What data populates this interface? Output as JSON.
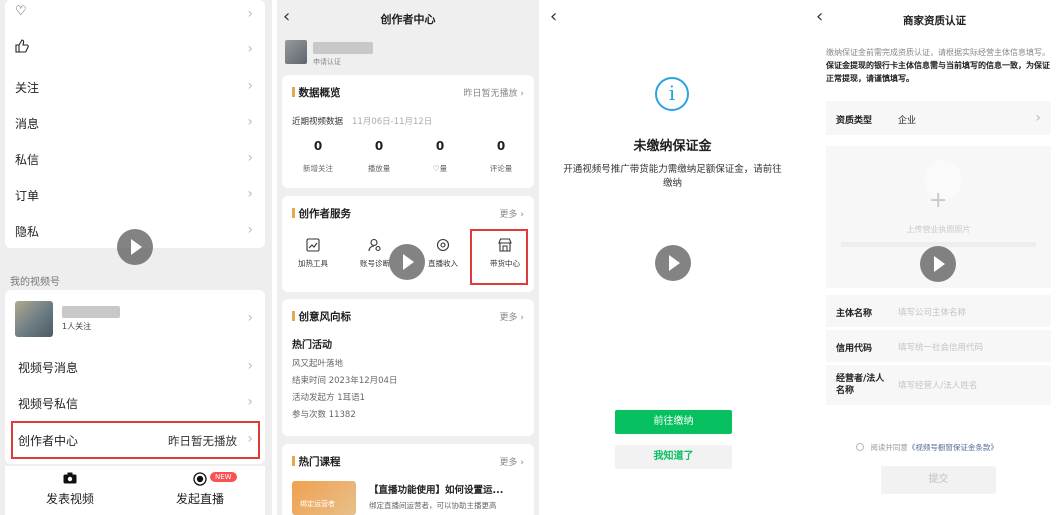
{
  "screen1": {
    "menu_items": [
      {
        "label": "",
        "icon": "heart-icon"
      },
      {
        "label": "",
        "icon": "thumbs-up-icon"
      },
      {
        "label": "关注"
      },
      {
        "label": "消息"
      },
      {
        "label": "私信"
      },
      {
        "label": "订单"
      },
      {
        "label": "隐私"
      }
    ],
    "section_label": "我的视频号",
    "profile_followers": "1人关注",
    "channel_items": [
      {
        "label": "视频号消息"
      },
      {
        "label": "视频号私信"
      }
    ],
    "creator_center": {
      "label": "创作者中心",
      "value": "昨日暂无播放"
    },
    "bottom_actions": [
      {
        "label": "发表视频",
        "icon": "camera-icon"
      },
      {
        "label": "发起直播",
        "icon": "live-icon"
      }
    ],
    "new_badge": "NEW"
  },
  "screen2": {
    "title": "创作者中心",
    "cert_text": "申请认证",
    "overview": {
      "title": "数据概览",
      "more": "昨日暂无播放",
      "period_label": "近期视频数据",
      "period_range": "11月06日-11月12日",
      "stats": [
        {
          "value": "0",
          "label": "新增关注"
        },
        {
          "value": "0",
          "label": "播放量"
        },
        {
          "value": "0",
          "label": "♡量"
        },
        {
          "value": "0",
          "label": "评论量"
        }
      ]
    },
    "services": {
      "title": "创作者服务",
      "more": "更多",
      "items": [
        {
          "label": "加热工具",
          "icon": "chart-icon"
        },
        {
          "label": "账号诊断",
          "icon": "user-diagnose-icon"
        },
        {
          "label": "直播收入",
          "icon": "live-income-icon"
        },
        {
          "label": "带货中心",
          "icon": "store-icon"
        }
      ]
    },
    "trends": {
      "title": "创意风向标",
      "more": "更多",
      "subtitle": "热门活动",
      "lines": [
        "风又起叶落地",
        "结束时间  2023年12月04日",
        "活动发起方  1耳语1",
        "参与次数  11382"
      ]
    },
    "courses": {
      "title": "热门课程",
      "more": "更多",
      "course_title": "【直播功能使用】如何设置运...",
      "course_desc": "绑定直播间运营者，可以协助主播更高",
      "thumb_text": "绑定运营者"
    }
  },
  "screen3": {
    "heading": "未缴纳保证金",
    "message": "开通视频号推广带货能力需缴纳足额保证金，请前往缴纳",
    "primary_button": "前往缴纳",
    "secondary_button": "我知道了"
  },
  "screen4": {
    "title": "商家资质认证",
    "notice_plain": "缴纳保证金前需完成资质认证，请根据实际经营主体信息填写。",
    "notice_bold": "保证金提现的银行卡主体信息需与当前填写的信息一致，为保证正常提现，请谨慎填写。",
    "type_label": "资质类型",
    "type_value": "企业",
    "upload_text": "上传营业执照照片",
    "fields": [
      {
        "label": "主体名称",
        "placeholder": "填写公司主体名称"
      },
      {
        "label": "信用代码",
        "placeholder": "填写统一社会信用代码"
      },
      {
        "label": "经营者/法人名称",
        "placeholder": "填写经营人/法人姓名"
      }
    ],
    "agreement_prefix": "阅读并同意",
    "agreement_link": "《视频号橱窗保证金条款》",
    "submit": "提交"
  },
  "colors": {
    "wechat_green": "#07c160",
    "highlight_red": "#e03b3b",
    "info_blue": "#2aa4e0",
    "accent_orange": "#e8a84a"
  }
}
